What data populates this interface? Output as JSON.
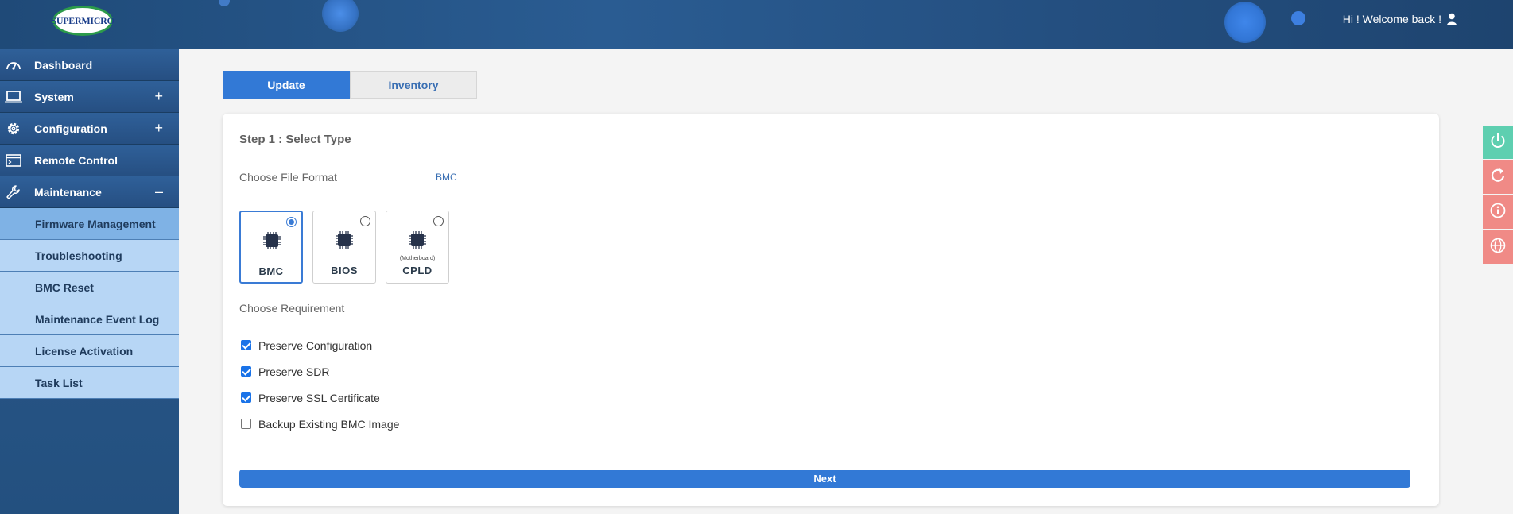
{
  "header": {
    "logo_text": "SUPERMICRO",
    "welcome": "Hi ! Welcome back !",
    "user_icon": "user-icon"
  },
  "sidebar": {
    "items": [
      {
        "label": "Dashboard",
        "icon": "dashboard-gauge-icon",
        "toggle": ""
      },
      {
        "label": "System",
        "icon": "laptop-icon",
        "toggle": "+"
      },
      {
        "label": "Configuration",
        "icon": "gear-icon",
        "toggle": "+"
      },
      {
        "label": "Remote Control",
        "icon": "terminal-icon",
        "toggle": ""
      },
      {
        "label": "Maintenance",
        "icon": "wrench-icon",
        "toggle": "–"
      }
    ],
    "maintenance_sub": [
      {
        "label": "Firmware Management",
        "active": true
      },
      {
        "label": "Troubleshooting"
      },
      {
        "label": "BMC Reset"
      },
      {
        "label": "Maintenance Event Log"
      },
      {
        "label": "License Activation"
      },
      {
        "label": "Task List"
      }
    ]
  },
  "tabs": [
    {
      "label": "Update",
      "active": true
    },
    {
      "label": "Inventory",
      "active": false
    }
  ],
  "step": {
    "title": "Step 1 : Select Type",
    "file_format_label": "Choose File Format",
    "file_format_value": "BMC",
    "types": [
      {
        "label": "BMC",
        "sub": "",
        "selected": true
      },
      {
        "label": "BIOS",
        "sub": "",
        "selected": false
      },
      {
        "label": "CPLD",
        "sub": "(Motherboard)",
        "selected": false
      }
    ],
    "requirement_label": "Choose Requirement",
    "requirements": [
      {
        "label": "Preserve Configuration",
        "checked": true
      },
      {
        "label": "Preserve SDR",
        "checked": true
      },
      {
        "label": "Preserve SSL Certificate",
        "checked": true
      },
      {
        "label": "Backup Existing BMC Image",
        "checked": false
      }
    ],
    "next_label": "Next"
  },
  "quick_actions": [
    {
      "icon": "power-icon",
      "color": "#5ecfb0"
    },
    {
      "icon": "refresh-icon",
      "color": "#f08a86"
    },
    {
      "icon": "info-icon",
      "color": "#f08a86"
    },
    {
      "icon": "globe-icon",
      "color": "#f08a86"
    }
  ],
  "colors": {
    "accent": "#3279d6",
    "header": "#2a5c92",
    "sidebar_sub": "#b7d6f5",
    "sidebar_sub_active": "#7fb2e5"
  }
}
